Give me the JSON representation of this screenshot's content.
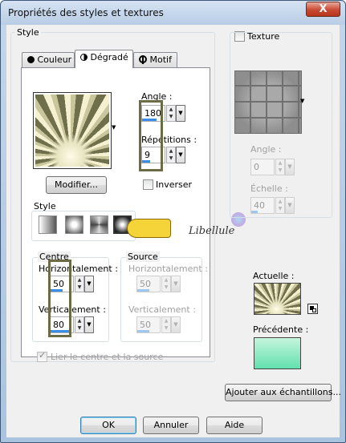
{
  "window": {
    "title": "Propriétés des styles et textures",
    "close_label": "X"
  },
  "style_group": {
    "title": "Style"
  },
  "tabs": [
    {
      "label": "Couleur",
      "icon": "circle-icon"
    },
    {
      "label": "Dégradé",
      "icon": "half-circle-icon"
    },
    {
      "label": "Motif",
      "icon": "globe-icon"
    }
  ],
  "gradient": {
    "angle_label": "Angle :",
    "angle_value": "180",
    "repetitions_label": "Répétitions :",
    "repetitions_value": "9",
    "modify_label": "Modifier...",
    "invert_label": "Inverser",
    "invert_checked": false,
    "style_group_title": "Style",
    "style_options": [
      "linear",
      "rectangular",
      "sunburst",
      "radial"
    ],
    "selected_style": "radial"
  },
  "centre": {
    "title": "Centre",
    "h_label": "Horizontalement :",
    "h_value": "50",
    "v_label": "Verticalement :",
    "v_value": "80"
  },
  "source": {
    "title": "Source",
    "h_label": "Horizontalement :",
    "h_value": "50",
    "v_label": "Verticalement :",
    "v_value": "50"
  },
  "link_label": "Lier le centre et la source",
  "link_checked": true,
  "texture": {
    "label": "Texture",
    "checked": false,
    "angle_label": "Angle :",
    "angle_value": "0",
    "scale_label": "Échelle :",
    "scale_value": "40"
  },
  "current_label": "Actuelle :",
  "previous_label": "Précédente :",
  "add_samples_label": "Ajouter aux échantillons...",
  "buttons": {
    "ok": "OK",
    "cancel": "Annuler",
    "help": "Aide"
  },
  "watermark": "Libellule",
  "colors": {
    "highlight": "#6b6c45",
    "accent": "#3b8ee6"
  }
}
